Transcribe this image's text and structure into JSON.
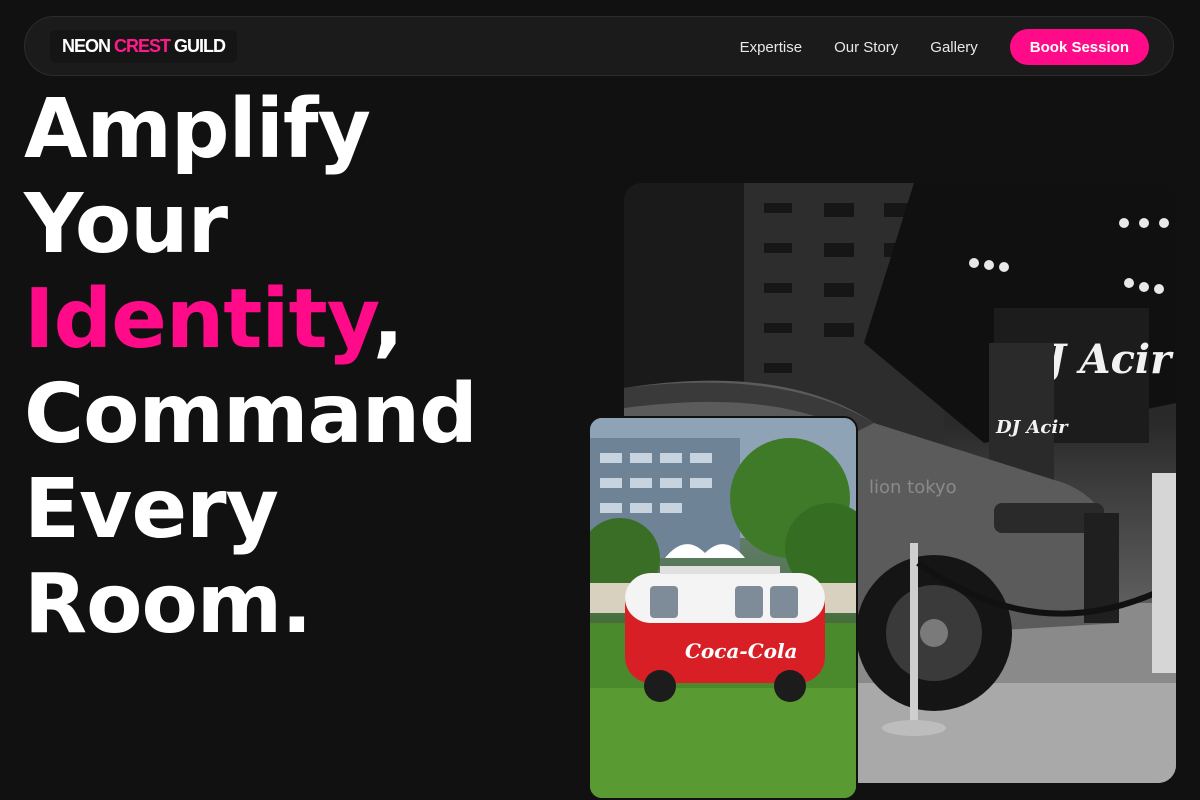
{
  "brand": {
    "logo_part1": "NEON",
    "logo_part2": "CREST",
    "logo_part3": "GUILD"
  },
  "nav": {
    "links": [
      {
        "label": "Expertise"
      },
      {
        "label": "Our Story"
      },
      {
        "label": "Gallery"
      }
    ],
    "cta_label": "Book Session"
  },
  "hero": {
    "line1": "Amplify",
    "line2": "Your",
    "line3_accent": "Identity",
    "line3_rest": ",",
    "line4": "Command",
    "line5": "Every",
    "line6": "Room."
  },
  "photos": {
    "stage_sign": "DJ Acir",
    "stage_sign_small": "DJ Acir",
    "watermark": "lion tokyo",
    "van_text": "Coca-Cola"
  },
  "colors": {
    "background": "#111111",
    "accent": "#ff0a88",
    "text": "#ffffff"
  }
}
